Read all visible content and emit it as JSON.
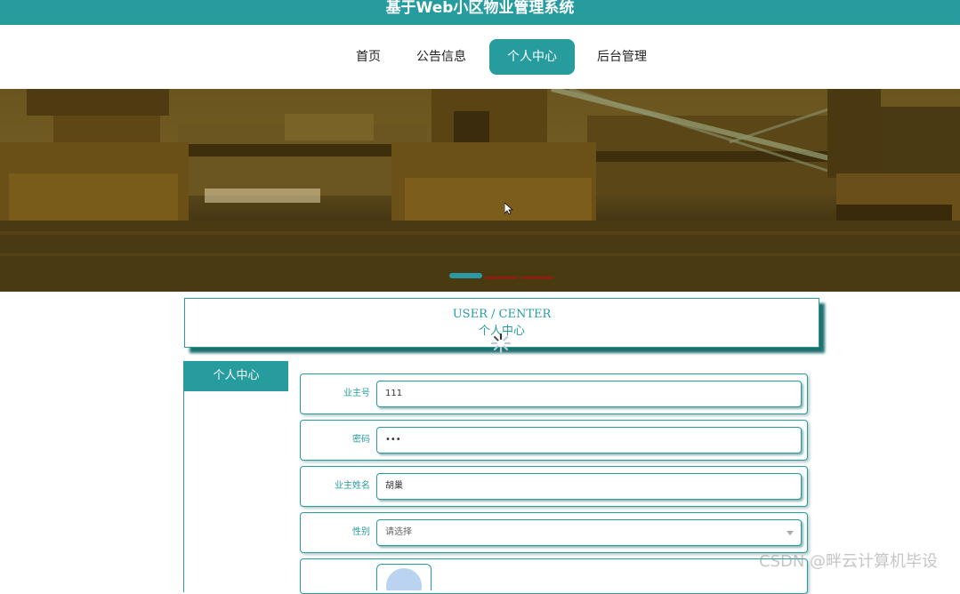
{
  "app": {
    "title": "基于Web小区物业管理系统"
  },
  "nav": {
    "items": [
      {
        "label": "首页",
        "active": false
      },
      {
        "label": "公告信息",
        "active": false
      },
      {
        "label": "个人中心",
        "active": true
      },
      {
        "label": "后台管理",
        "active": false
      }
    ]
  },
  "carousel": {
    "slide_count": 3,
    "active_index": 0
  },
  "section": {
    "title_en": "USER / CENTER",
    "title_cn": "个人中心"
  },
  "sidebar": {
    "heading": "个人中心"
  },
  "form": {
    "fields": [
      {
        "label": "业主号",
        "value": "111",
        "type": "text"
      },
      {
        "label": "密码",
        "value": "•••",
        "type": "password"
      },
      {
        "label": "业主姓名",
        "value": "胡巢",
        "type": "text"
      },
      {
        "label": "性别",
        "value": "请选择",
        "type": "select"
      }
    ]
  },
  "watermark": {
    "text": "CSDN @畔云计算机毕设"
  },
  "colors": {
    "accent": "#279c9f",
    "accent_dark": "#1f6f70",
    "dot_active": "#2a9aa4",
    "dot_inactive": "#8a1f14"
  }
}
